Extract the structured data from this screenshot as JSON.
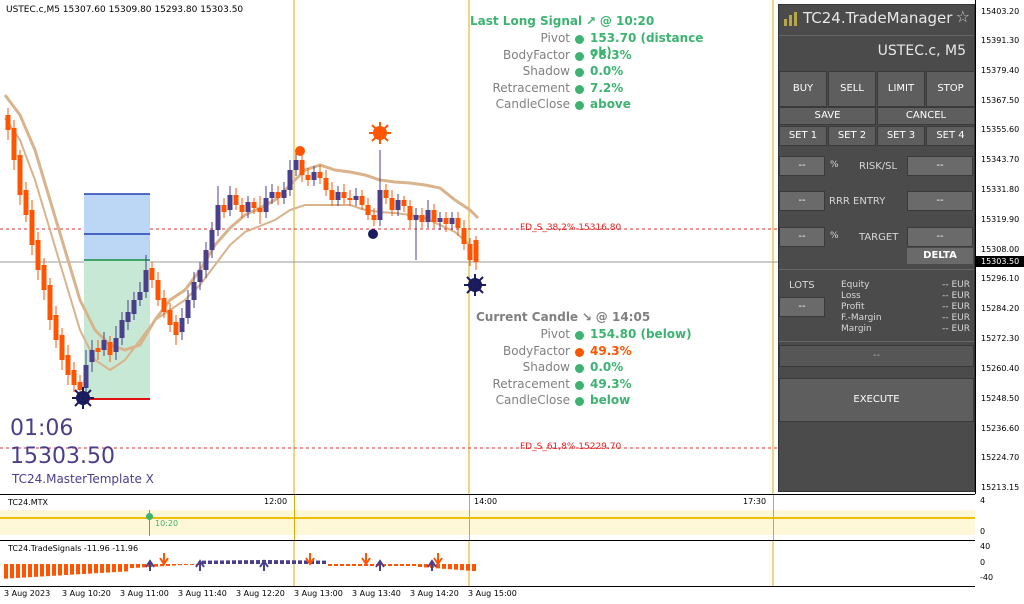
{
  "chart": {
    "symbol_header": "USTEC.c,M5   15307.60 15309.80 15293.80 15303.50",
    "price_ticks": [
      "15403.20",
      "15391.30",
      "15379.40",
      "15367.50",
      "15355.60",
      "15343.70",
      "15331.80",
      "15319.90",
      "15308.00",
      "15296.10",
      "15284.20",
      "15272.30",
      "15260.40",
      "15248.50",
      "15236.60",
      "15224.70",
      "15213.15"
    ],
    "current_price_tag": "15303.50",
    "fd_levels": [
      {
        "label": "FD_S_38,2%  15316.80"
      },
      {
        "label": "FD_S_61,8%  15229.70"
      }
    ],
    "big_time": "01:06",
    "big_price": "15303.50",
    "template_name": "TC24.MasterTemplate X",
    "candles_bullish_color": "#4a3f8a",
    "candles_bearish_color": "#ff5500",
    "ma_color": "#d9b38c"
  },
  "last_signal": {
    "header": "Last Long Signal",
    "header_arrow": "↗",
    "header_time": "@ 10:20",
    "rows": [
      {
        "label": "Pivot",
        "value": "153.70 (distance ok)",
        "status": "green"
      },
      {
        "label": "BodyFactor",
        "value": "78.3%",
        "status": "green"
      },
      {
        "label": "Shadow",
        "value": "0.0%",
        "status": "green"
      },
      {
        "label": "Retracement",
        "value": "7.2%",
        "status": "green"
      },
      {
        "label": "CandleClose",
        "value": "above",
        "status": "green"
      }
    ]
  },
  "current_candle": {
    "header": "Current Candle",
    "header_arrow": "↘",
    "header_time": "@ 14:05",
    "rows": [
      {
        "label": "Pivot",
        "value": "154.80 (below)",
        "status": "green"
      },
      {
        "label": "BodyFactor",
        "value": "49.3%",
        "status": "orange"
      },
      {
        "label": "Shadow",
        "value": "0.0%",
        "status": "green"
      },
      {
        "label": "Retracement",
        "value": "49.3%",
        "status": "green"
      },
      {
        "label": "CandleClose",
        "value": "below",
        "status": "green"
      }
    ]
  },
  "trade_manager": {
    "title": "TC24.TradeManager",
    "symbol": "USTEC.c, M5",
    "buttons": {
      "buy": "BUY",
      "sell": "SELL",
      "limit": "LIMIT",
      "stop": "STOP",
      "save": "SAVE",
      "cancel": "CANCEL",
      "set1": "SET 1",
      "set2": "SET 2",
      "set3": "SET 3",
      "set4": "SET 4",
      "execute": "EXECUTE",
      "delta": "DELTA"
    },
    "risk_sl_label": "RISK/SL",
    "rrr_entry_label": "RRR ENTRY",
    "target_label": "TARGET",
    "percent": "%",
    "placeholder": "--",
    "lots_label": "LOTS",
    "account": [
      {
        "label": "Equity",
        "value": "-- EUR"
      },
      {
        "label": "Loss",
        "value": "-- EUR"
      },
      {
        "label": "Profit",
        "value": "-- EUR"
      },
      {
        "label": "F.-Margin",
        "value": "-- EUR"
      },
      {
        "label": "Margin",
        "value": "-- EUR"
      }
    ]
  },
  "mtx_panel": {
    "title": "TC24.MTX",
    "time_labels": [
      "12:00",
      "14:00",
      "17:30"
    ],
    "signal_marker": "10:20",
    "axis": [
      "4",
      "0"
    ]
  },
  "signals_panel": {
    "title": "TC24.TradeSignals -11.96 -11.96",
    "axis": [
      "40",
      "0",
      "-40"
    ]
  },
  "time_axis": [
    "3 Aug 2023",
    "3 Aug 10:20",
    "3 Aug 11:00",
    "3 Aug 11:40",
    "3 Aug 12:20",
    "3 Aug 13:00",
    "3 Aug 13:40",
    "3 Aug 14:20",
    "3 Aug 15:00"
  ]
}
